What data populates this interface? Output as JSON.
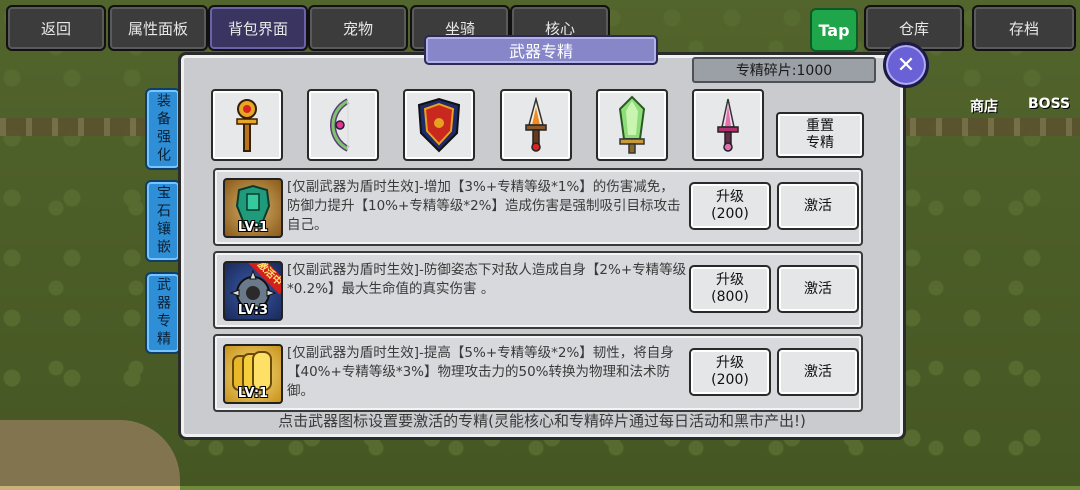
{
  "topnav": {
    "back": "返回",
    "attributes": "属性面板",
    "backpack": "背包界面",
    "pets": "宠物",
    "mount": "坐骑",
    "core": "核心",
    "tap": "Tap",
    "warehouse": "仓库",
    "save": "存档"
  },
  "hud": {
    "shop": "商店",
    "boss": "BOSS"
  },
  "sidetabs": {
    "equip_enhance": "装备强化",
    "gem_inlay": "宝石镶嵌",
    "weapon_mastery": "武器专精"
  },
  "panel": {
    "title": "武器专精",
    "shard_label": "专精碎片:1000",
    "reset_line1": "重置",
    "reset_line2": "专精",
    "footer": "点击武器图标设置要激活的专精(灵能核心和专精碎片通过每日活动和黑市产出!)"
  },
  "weapons": [
    {
      "icon": "golden-scepter-icon"
    },
    {
      "icon": "green-bow-icon"
    },
    {
      "icon": "red-shield-icon"
    },
    {
      "icon": "flame-dagger-icon"
    },
    {
      "icon": "green-crystal-sword-icon"
    },
    {
      "icon": "pink-dagger-icon"
    }
  ],
  "masteries": [
    {
      "icon": "green-armor-icon",
      "level": "LV:1",
      "desc": "[仅副武器为盾时生效]-增加【3%+专精等级*1%】的伤害减免，防御力提升【10%+专精等级*2%】造成伤害是强制吸引目标攻击自己。",
      "upgrade_label": "升级",
      "upgrade_cost": "(200)",
      "activate": "激活",
      "active": false
    },
    {
      "icon": "spiked-shield-icon",
      "level": "LV:3",
      "badge": "激活中",
      "desc": "[仅副武器为盾时生效]-防御姿态下对敌人造成自身【2%+专精等级*0.2%】最大生命值的真实伤害 。",
      "upgrade_label": "升级",
      "upgrade_cost": "(800)",
      "activate": "激活",
      "active": true
    },
    {
      "icon": "golden-shields-icon",
      "level": "LV:1",
      "desc": "[仅副武器为盾时生效]-提高【5%+专精等级*2%】韧性，将自身【40%+专精等级*3%】物理攻击力的50%转换为物理和法术防御。",
      "upgrade_label": "升级",
      "upgrade_cost": "(200)",
      "activate": "激活",
      "active": false
    }
  ],
  "colors": {
    "panel_bg": "#c9cbcf",
    "title_bg": "#8686c9",
    "tab_blue": "#2f8fd6",
    "close_purple": "#6b61d6",
    "active_badge": "#d21f1f"
  }
}
